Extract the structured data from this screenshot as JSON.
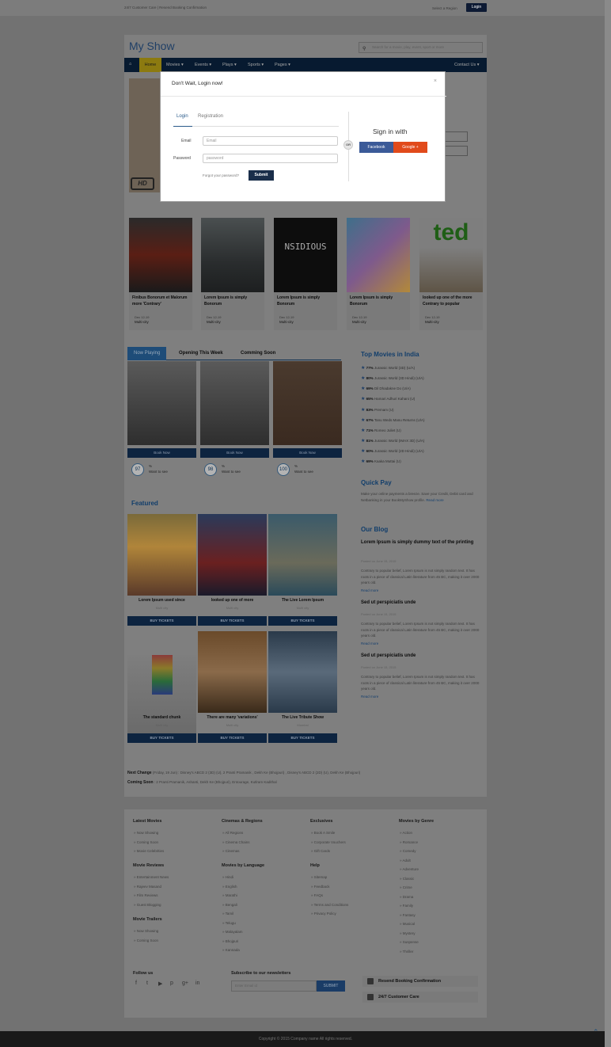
{
  "topbar": {
    "left": "24/7 Customer Care | Resend Booking Confirmation",
    "right": "Select a Region",
    "login": "Login"
  },
  "header": {
    "logo": "My Show",
    "search_placeholder": "Search for a movie, play, event, sport or more"
  },
  "nav": {
    "items": [
      "Home",
      "Movies ▾",
      "Events ▾",
      "Plays ▾",
      "Sports ▾",
      "Pages ▾"
    ],
    "contact": "Contact Us ▾"
  },
  "cards": [
    {
      "title": "Finibus Bonorum et Malorum more 'Contrary'",
      "date": "Dec 12-19",
      "city": "Multi-city"
    },
    {
      "title": "Lorem Ipsum is simply Bonorum",
      "date": "Dec 12-19",
      "city": "Multi-city"
    },
    {
      "title": "Lorem Ipsum is simply Bonorum",
      "date": "Dec 12-19",
      "city": "Multi-city"
    },
    {
      "title": "Lorem Ipsum is simply Bonorum",
      "date": "Dec 12-19",
      "city": "Multi-city"
    },
    {
      "title": "looked up one of the more Contrary to popular",
      "date": "Dec 12-19",
      "city": "Multi-city"
    }
  ],
  "tabs": [
    "Now Playing",
    "Opening This Week",
    "Comming Soon"
  ],
  "now_playing": [
    {
      "btn": "Book Now",
      "score": "97",
      "pct": "%",
      "want": "Want to see"
    },
    {
      "btn": "Book Now",
      "score": "98",
      "pct": "%",
      "want": "Want to see"
    },
    {
      "btn": "Book Now",
      "score": "100",
      "pct": "%",
      "want": "Want to see"
    }
  ],
  "featured_title": "Featured",
  "featured": [
    {
      "title": "Lorem Ipsum used since",
      "sub": "Multi city",
      "btn": "BUY TICKETS"
    },
    {
      "title": "looked up one of more",
      "sub": "Multi city",
      "btn": "BUY TICKETS"
    },
    {
      "title": "The Live Lorem Ipsum",
      "sub": "Multi city",
      "btn": "BUY TICKETS"
    },
    {
      "title": "The standard chunk",
      "sub": "Multi city",
      "btn": "BUY TICKETS"
    },
    {
      "title": "There are many 'variations'",
      "sub": "Multi city",
      "btn": "BUY TICKETS"
    },
    {
      "title": "The Live Tribute Show",
      "sub": "Mumbai",
      "btn": "BUY TICKETS"
    }
  ],
  "top_movies": {
    "title": "Top Movies in India",
    "items": [
      {
        "pct": "77%",
        "name": "Jurassic World (3D) (U/A)"
      },
      {
        "pct": "80%",
        "name": "Jurassic World (3D Hindi) (U/A)"
      },
      {
        "pct": "69%",
        "name": "Dil Dhadakne Do (U/A)"
      },
      {
        "pct": "65%",
        "name": "Hamari Adhuri Kahani (U)"
      },
      {
        "pct": "83%",
        "name": "Premam (U)"
      },
      {
        "pct": "67%",
        "name": "Tanu Weds Manu Returns (U/A)"
      },
      {
        "pct": "71%",
        "name": "Romeo Juliet (U)"
      },
      {
        "pct": "81%",
        "name": "Jurassic World (IMAX 3D) (U/A)"
      },
      {
        "pct": "60%",
        "name": "Jurassic World (2D Hindi) (U/A)"
      },
      {
        "pct": "69%",
        "name": "Kaaka Muttai (U)"
      }
    ]
  },
  "quick_pay": {
    "title": "Quick Pay",
    "text": "Make your online payments a breeze. Save your Credit, Debit card and Netbanking in your BookMyShow profile.",
    "link": "Read more"
  },
  "blog": {
    "title": "Our Blog",
    "posts": [
      {
        "title": "Lorem Ipsum is simply dummy text of the printing",
        "date": "Posted on June 15, 2015",
        "text": "Contrary to popular belief, Lorem Ipsum is not simply random text. It has roots in a piece of classical Latin literature from 45 BC, making it over 2000 years old.",
        "more": "Read more"
      },
      {
        "title": "Sed ut perspiciatis unde",
        "date": "Posted on June 15, 2015",
        "text": "Contrary to popular belief, Lorem Ipsum is not simply random text. It has roots in a piece of classical Latin literature from 45 BC, making it over 2000 years old.",
        "more": "Read more"
      },
      {
        "title": "Sed ut perspiciatis unde",
        "date": "Posted on June 15, 2015",
        "text": "Contrary to popular belief, Lorem Ipsum is not simply random text. It has roots in a piece of classical Latin literature from 45 BC, making it over 2000 years old.",
        "more": "Read more"
      }
    ]
  },
  "ticker": {
    "next_label": "Next Change",
    "next_text": "(Friday, 19 Jun) : Disney's ABCD 2 (3D) (U), 2 Pranti Pramanik , Dekh Ke (Bhojpuri) , Disney's ABCD 2 (2D) (U), Dekh Ke (Bhojpuri)",
    "soon_label": "Coming Soon",
    "soon_text": ": 2 Pranti Pramanik, Ashanti, Dekh Ke (Bhojpuri), Entourage, Kutlram Kadithal"
  },
  "footer": {
    "cols": [
      {
        "h": "Latest Movies",
        "items": [
          "Now Showing",
          "Coming Soon",
          "Movie Celebrities"
        ]
      },
      {
        "h": "Movie Reviews",
        "items": [
          "Entertainment News",
          "Rajeev Masand",
          "Film Reviews",
          "Guest Blogging"
        ]
      },
      {
        "h": "Movie Trailers",
        "items": [
          "Now Showing",
          "Coming Soon"
        ]
      },
      {
        "h": "Cinemas & Regions",
        "items": [
          "All Regions",
          "Cinema Chains",
          "Cinemas"
        ]
      },
      {
        "h": "Movies by Language",
        "items": [
          "Hindi",
          "English",
          "Marathi",
          "Bengali",
          "Tamil",
          "Telugu",
          "Malayalam",
          "Bhojpuri",
          "Kannada"
        ]
      },
      {
        "h": "Exclusives",
        "items": [
          "Book A Smile",
          "Corporate Vouchers",
          "Gift Cards"
        ]
      },
      {
        "h": "Help",
        "items": [
          "Sitemap",
          "Feedback",
          "FAQs",
          "Terms and Conditions",
          "Privacy Policy"
        ]
      },
      {
        "h": "Movies by Genre",
        "items": [
          "Action",
          "Romance",
          "Comedy",
          "Adult",
          "Adventure",
          "Classic",
          "Crime",
          "Drama",
          "Family",
          "Fantasy",
          "Musical",
          "Mystery",
          "Suspense",
          "Thriller"
        ]
      }
    ],
    "follow": "Follow us",
    "newsletter": "Subscribe to our newsletters",
    "email_placeholder": "Enter Email id",
    "submit": "SUBMIT",
    "resend": "Resend Booking Confirmation",
    "care": "24/7 Customer Care",
    "copyright": "Copyright © 2015 Company name All rights reserved."
  },
  "modal": {
    "title": "Don't Wait, Login now!",
    "close": "×",
    "tab_login": "Login",
    "tab_reg": "Registration",
    "email_label": "Email",
    "email_ph": "Email",
    "pass_label": "Password",
    "pass_ph": "password",
    "forgot": "Forgot your password?",
    "submit": "Submit",
    "or": "OR",
    "sign_in": "Sign in with",
    "facebook": "Facebook",
    "google": "Google +"
  }
}
